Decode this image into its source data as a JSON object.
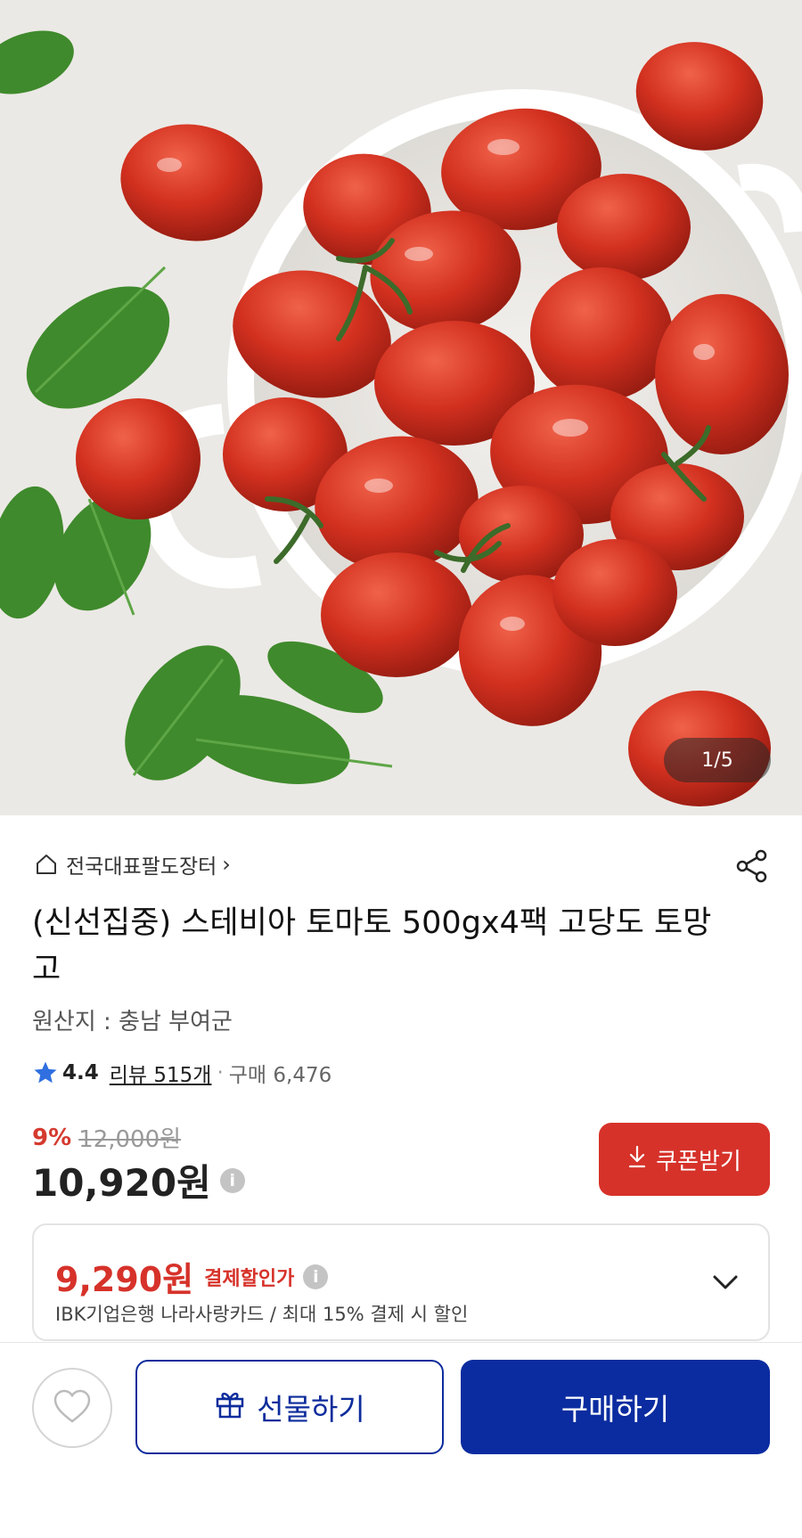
{
  "gallery": {
    "counter": "1/5",
    "image": "cherry-tomatoes-in-white-bowl"
  },
  "seller": {
    "name": "전국대표팔도장터",
    "chevron": "›",
    "icon": "home-icon"
  },
  "product": {
    "title": "(신선집중) 스테비아 토마토 500gx4팩  고당도 토망고",
    "origin": "원산지 : 충남 부여군"
  },
  "rating": {
    "score": "4.4",
    "reviews": "리뷰 515개",
    "separator": "·",
    "purchases": "구매 6,476"
  },
  "price": {
    "discount_rate": "9%",
    "original": "12,000원",
    "current": "10,920원",
    "info": "i"
  },
  "coupon": {
    "label": "쿠폰받기"
  },
  "payment_discount": {
    "price": "9,290원",
    "label": "결제할인가",
    "info": "i",
    "detail": "IBK기업은행 나라사랑카드 / 최대 15% 결제 시 할인"
  },
  "actions": {
    "gift_label": "선물하기",
    "buy_label": "구매하기"
  },
  "colors": {
    "accent_red": "#d6322a",
    "brand_blue": "#0b2ca0",
    "star_blue": "#2f6fe0"
  }
}
